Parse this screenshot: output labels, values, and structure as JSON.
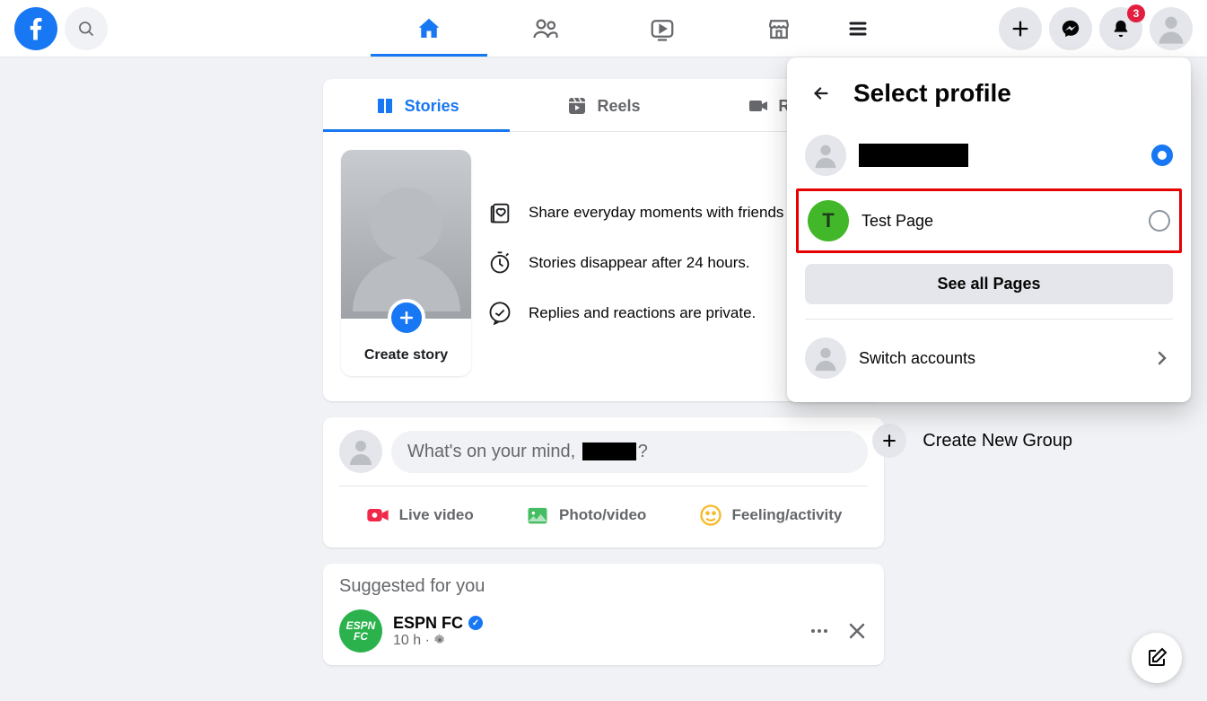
{
  "header": {
    "notifications_badge": "3"
  },
  "tabs": {
    "stories": "Stories",
    "reels": "Reels",
    "rooms": "Rooms"
  },
  "stories": {
    "create_label": "Create story",
    "bullet1": "Share everyday moments with friends and family.",
    "bullet2": "Stories disappear after 24 hours.",
    "bullet3": "Replies and reactions are private."
  },
  "composer": {
    "prompt_prefix": "What's on your mind,",
    "prompt_suffix": "?",
    "live": "Live video",
    "photo": "Photo/video",
    "feeling": "Feeling/activity"
  },
  "suggested": {
    "title": "Suggested for you",
    "name": "ESPN FC",
    "time": "10 h"
  },
  "dropdown": {
    "title": "Select profile",
    "test_page_letter": "T",
    "test_page": "Test Page",
    "see_all": "See all Pages",
    "switch": "Switch accounts"
  },
  "create_group": "Create New Group"
}
